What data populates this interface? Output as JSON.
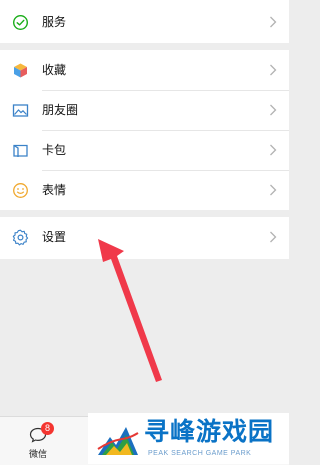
{
  "menu": {
    "service": {
      "label": "服务",
      "icon": "service-icon"
    },
    "items": [
      {
        "label": "收藏",
        "icon": "favorites-cube-icon"
      },
      {
        "label": "朋友圈",
        "icon": "moments-image-icon"
      },
      {
        "label": "卡包",
        "icon": "card-wallet-icon"
      },
      {
        "label": "表情",
        "icon": "sticker-smile-icon"
      }
    ],
    "settings": {
      "label": "设置",
      "icon": "gear-icon"
    }
  },
  "tabbar": {
    "wechat_label": "微信",
    "wechat_badge": "8"
  },
  "watermark": {
    "cn": "寻峰游戏园",
    "en": "PEAK SEARCH GAME PARK"
  },
  "colors": {
    "accent_green": "#1aad19",
    "arrow_red": "#f0394a",
    "badge_red": "#f43530",
    "watermark_blue": "#0a73c6"
  }
}
